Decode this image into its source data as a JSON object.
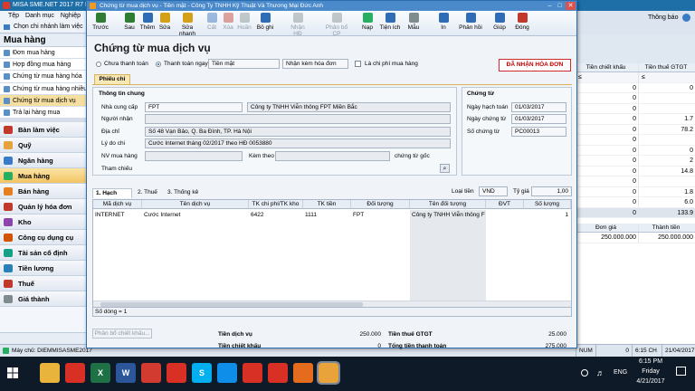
{
  "main_window": {
    "title": "MISA SME.NET 2017 R7 Pro",
    "menu": [
      "Tệp",
      "Danh mục",
      "Nghiệp vụ"
    ],
    "company_selector": "Chọn chi nhánh làm việc",
    "notification": "Thông báo"
  },
  "left_panel": {
    "header": "Mua hàng",
    "items": [
      {
        "label": "Đơn mua hàng"
      },
      {
        "label": "Hợp đồng mua hàng"
      },
      {
        "label": "Chứng từ mua hàng hóa"
      },
      {
        "label": "Chứng từ mua hàng nhiều h"
      },
      {
        "label": "Chứng từ mua dịch vụ"
      },
      {
        "label": "Trả lại hàng mua"
      }
    ],
    "modules": [
      {
        "label": "Bàn làm việc",
        "color": "#c0392b"
      },
      {
        "label": "Quỹ",
        "color": "#e6a23c"
      },
      {
        "label": "Ngân hàng",
        "color": "#3a7bc8"
      },
      {
        "label": "Mua hàng",
        "color": "#27ae60"
      },
      {
        "label": "Bán hàng",
        "color": "#e67e22"
      },
      {
        "label": "Quản lý hóa đơn",
        "color": "#c0392b"
      },
      {
        "label": "Kho",
        "color": "#8e44ad"
      },
      {
        "label": "Công cụ dụng cụ",
        "color": "#d35400"
      },
      {
        "label": "Tài sản cố định",
        "color": "#16a085"
      },
      {
        "label": "Tiền lương",
        "color": "#2980b9"
      },
      {
        "label": "Thuế",
        "color": "#c0392b"
      },
      {
        "label": "Giá thành",
        "color": "#7f8c8d"
      }
    ]
  },
  "right_panel": {
    "headers": [
      "Tiền chiết khấu",
      "Tiền thuế GTGT"
    ],
    "filter_symbols": [
      "≤",
      "≤"
    ],
    "rows": [
      {
        "c1": "0",
        "c2": "0"
      },
      {
        "c1": "0",
        "c2": ""
      },
      {
        "c1": "0",
        "c2": ""
      },
      {
        "c1": "0",
        "c2": "1.7"
      },
      {
        "c1": "0",
        "c2": "78.2"
      },
      {
        "c1": "0",
        "c2": ""
      },
      {
        "c1": "0",
        "c2": "0"
      },
      {
        "c1": "0",
        "c2": "2"
      },
      {
        "c1": "0",
        "c2": "14.8"
      },
      {
        "c1": "0",
        "c2": ""
      },
      {
        "c1": "0",
        "c2": "1.8"
      },
      {
        "c1": "0",
        "c2": "6.0"
      },
      {
        "c1": "0",
        "c2": "133.9"
      }
    ],
    "detail_headers": [
      "Đơn giá",
      "Thành tiền"
    ],
    "detail_row": [
      "250.000.000",
      "250.000.000"
    ]
  },
  "status_bar": {
    "machine": "Máy chủ: DIEMMISASME2017",
    "num": "NUM",
    "zero": "0",
    "time": "6:15 CH",
    "date": "21/04/2017"
  },
  "dialog": {
    "title": "Chứng từ mua dịch vụ - Tiền mặt - Công Ty TNHH Kỹ Thuật Và Thương Mại Đức Anh",
    "toolbar": [
      {
        "label": "Trước",
        "disabled": false,
        "color": "#2f7d32"
      },
      {
        "label": "Sau",
        "disabled": false,
        "color": "#2f7d32"
      },
      {
        "label": "Thêm",
        "disabled": false,
        "color": "#2e6db5"
      },
      {
        "label": "Sửa",
        "disabled": false,
        "color": "#d4a017"
      },
      {
        "label": "Sửa nhanh",
        "disabled": false,
        "color": "#d4a017"
      },
      {
        "label": "Cất",
        "disabled": true,
        "color": "#2e6db5"
      },
      {
        "label": "Xóa",
        "disabled": true,
        "color": "#c0392b"
      },
      {
        "label": "Hoãn",
        "disabled": true,
        "color": "#7f8c8d"
      },
      {
        "label": "Bỏ ghi",
        "disabled": false,
        "color": "#2e6db5"
      },
      {
        "label": "Nhận HĐ",
        "disabled": true,
        "color": "#7f8c8d"
      },
      {
        "label": "Phân bổ CP",
        "disabled": true,
        "color": "#7f8c8d"
      },
      {
        "label": "Nạp",
        "disabled": false,
        "color": "#27ae60"
      },
      {
        "label": "Tiện ích",
        "disabled": false,
        "color": "#2e6db5"
      },
      {
        "label": "Mẫu",
        "disabled": false,
        "color": "#7f8c8d"
      },
      {
        "label": "In",
        "disabled": false,
        "color": "#2e6db5"
      },
      {
        "label": "Phản hồi",
        "disabled": false,
        "color": "#2e6db5"
      },
      {
        "label": "Giúp",
        "disabled": false,
        "color": "#2e6db5"
      },
      {
        "label": "Đóng",
        "disabled": false,
        "color": "#c0392b"
      }
    ],
    "doc_title": "Chứng từ mua dịch vụ",
    "radio_unpaid": "Chưa thanh toán",
    "radio_paid": "Thanh toán ngay",
    "payment_method": "Tiền mặt",
    "invoice_option": "Nhận kèm hóa đơn",
    "cost_checkbox": "Là chi phí mua hàng",
    "received_badge": "ĐÃ NHẬN HÓA ĐƠN",
    "tab_phieuchi": "Phiếu chi",
    "general_info": {
      "title": "Thông tin chung",
      "supplier_label": "Nhà cung cấp",
      "supplier_code": "FPT",
      "supplier_name": "Công ty TNHH Viễn thông FPT Miền Bắc",
      "receiver_label": "Người nhận",
      "receiver": "",
      "address_label": "Địa chỉ",
      "address": "Số 48 Vạn Bảo, Q. Ba Đình, TP. Hà Nội",
      "reason_label": "Lý do chi",
      "reason": "Cước Internet tháng 02/2017 theo HĐ 0053880",
      "staff_label": "NV mua hàng",
      "staff": "",
      "attach_label": "Kèm theo",
      "attach": "",
      "original_doc": "chứng từ gốc",
      "reference_label": "Tham chiếu"
    },
    "voucher": {
      "title": "Chứng từ",
      "accounting_date_label": "Ngày hạch toán",
      "accounting_date": "01/03/2017",
      "voucher_date_label": "Ngày chứng từ",
      "voucher_date": "01/03/2017",
      "voucher_no_label": "Số chứng từ",
      "voucher_no": "PC00013"
    },
    "currency_label": "Loại tiền",
    "currency": "VND",
    "rate_label": "Tỷ giá",
    "rate": "1,00",
    "detail_tabs": [
      "1. Hạch toán",
      "2. Thuế",
      "3. Thống kê"
    ],
    "grid_headers": [
      "Mã dịch vụ",
      "Tên dịch vụ",
      "TK chi phí/TK kho",
      "TK tiền",
      "Đối tượng",
      "Tên đối tượng",
      "ĐVT",
      "Số lượng"
    ],
    "grid_rows": [
      [
        "INTERNET",
        "Cước Internet",
        "6422",
        "1111",
        "FPT",
        "Công ty TNHH Viễn thông F",
        "",
        "1"
      ]
    ],
    "row_count": "Số dòng = 1",
    "allocate_button": "Phân bổ chiết khấu...",
    "totals": {
      "service_label": "Tiền dịch vụ",
      "service": "250.000",
      "discount_label": "Tiền chiết khấu",
      "discount": "0",
      "vat_label": "Tiền thuế GTGT",
      "vat": "25.000",
      "total_label": "Tổng tiền thanh toán",
      "total": "275.000"
    }
  },
  "taskbar": {
    "apps": [
      {
        "name": "file-explorer-icon",
        "color": "#e8b43b",
        "glyph": ""
      },
      {
        "name": "chrome-icon",
        "color": "#d93025",
        "glyph": ""
      },
      {
        "name": "excel-icon",
        "color": "#1e7145",
        "glyph": "X"
      },
      {
        "name": "word-icon",
        "color": "#2b579a",
        "glyph": "W"
      },
      {
        "name": "misa-icon",
        "color": "#d23b2f",
        "glyph": ""
      },
      {
        "name": "chrome-icon",
        "color": "#d93025",
        "glyph": ""
      },
      {
        "name": "skype-icon",
        "color": "#00aff0",
        "glyph": "S"
      },
      {
        "name": "teamviewer-icon",
        "color": "#0e8ee9",
        "glyph": ""
      },
      {
        "name": "chrome-icon",
        "color": "#d93025",
        "glyph": ""
      },
      {
        "name": "chrome-icon",
        "color": "#d93025",
        "glyph": ""
      },
      {
        "name": "misa-sme-icon",
        "color": "#e56b1f",
        "glyph": ""
      },
      {
        "name": "misa-active-icon",
        "color": "#e8a33a",
        "glyph": ""
      }
    ],
    "language": "ENG",
    "clock_time": "6:15 PM",
    "clock_day": "Friday",
    "clock_date": "4/21/2017"
  }
}
